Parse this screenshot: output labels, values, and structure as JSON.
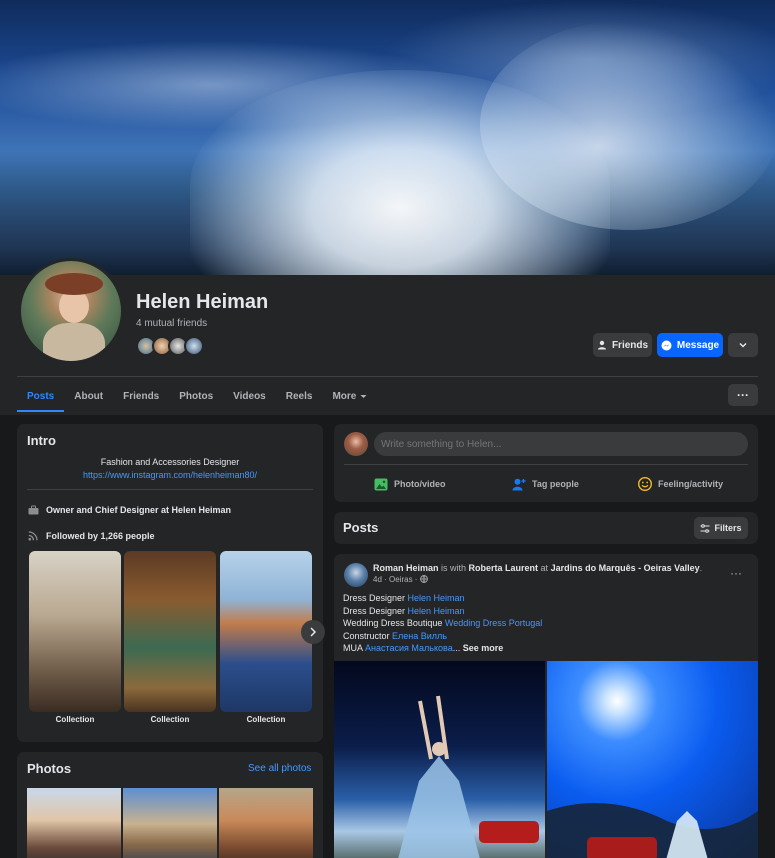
{
  "profile": {
    "name": "Helen Heiman",
    "mutual_friends": "4 mutual friends"
  },
  "actions": {
    "friends_label": "Friends",
    "message_label": "Message"
  },
  "tabs": [
    {
      "label": "Posts"
    },
    {
      "label": "About"
    },
    {
      "label": "Friends"
    },
    {
      "label": "Photos"
    },
    {
      "label": "Videos"
    },
    {
      "label": "Reels"
    },
    {
      "label": "More"
    }
  ],
  "intro": {
    "title": "Intro",
    "bio": "Fashion and Accessories Designer",
    "link": "https://www.instagram.com/helenheiman80/",
    "work": "Owner and Chief Designer at Helen Heiman",
    "followers": "Followed by 1,266 people",
    "featured": [
      {
        "label": "Collection"
      },
      {
        "label": "Collection"
      },
      {
        "label": "Collection"
      }
    ]
  },
  "photos": {
    "title": "Photos",
    "see_all": "See all photos"
  },
  "composer": {
    "placeholder": "Write something to Helen...",
    "actions": [
      {
        "label": "Photo/video"
      },
      {
        "label": "Tag people"
      },
      {
        "label": "Feeling/activity"
      }
    ]
  },
  "posts": {
    "title": "Posts",
    "filters_label": "Filters"
  },
  "post": {
    "author": "Roman Heiman",
    "is_with_text": " is with ",
    "with": "Roberta Laurent",
    "at_text": " at ",
    "location": "Jardins do Marquês - Oeiras Valley",
    "period": ".",
    "meta": "4d · Oeiras · ",
    "lines": [
      {
        "role": "Dress Designer ",
        "tag": "Helen Heiman"
      },
      {
        "role": "Dress Designer ",
        "tag": "Helen Heiman"
      },
      {
        "role": "Wedding Dress Boutique ",
        "tag": "Wedding Dress Portugal"
      },
      {
        "role": "Constructor ",
        "tag": "Елена Вилль"
      },
      {
        "role": "MUA ",
        "tag": "Анастасия Малькова",
        "suffix": "... ",
        "more": "See more"
      }
    ]
  },
  "colors": {
    "background": "#18191a",
    "card": "#242526",
    "accent": "#2d88ff",
    "message_button": "#0866ff",
    "link": "#4599ff"
  },
  "icons": {
    "friends": "person-check-icon",
    "message": "messenger-icon",
    "work": "briefcase-icon",
    "followers": "rss-icon",
    "photo_video": "photo-icon",
    "tag_people": "tag-person-icon",
    "feeling": "smiley-icon",
    "filters": "sliders-icon",
    "privacy": "globe-icon"
  }
}
